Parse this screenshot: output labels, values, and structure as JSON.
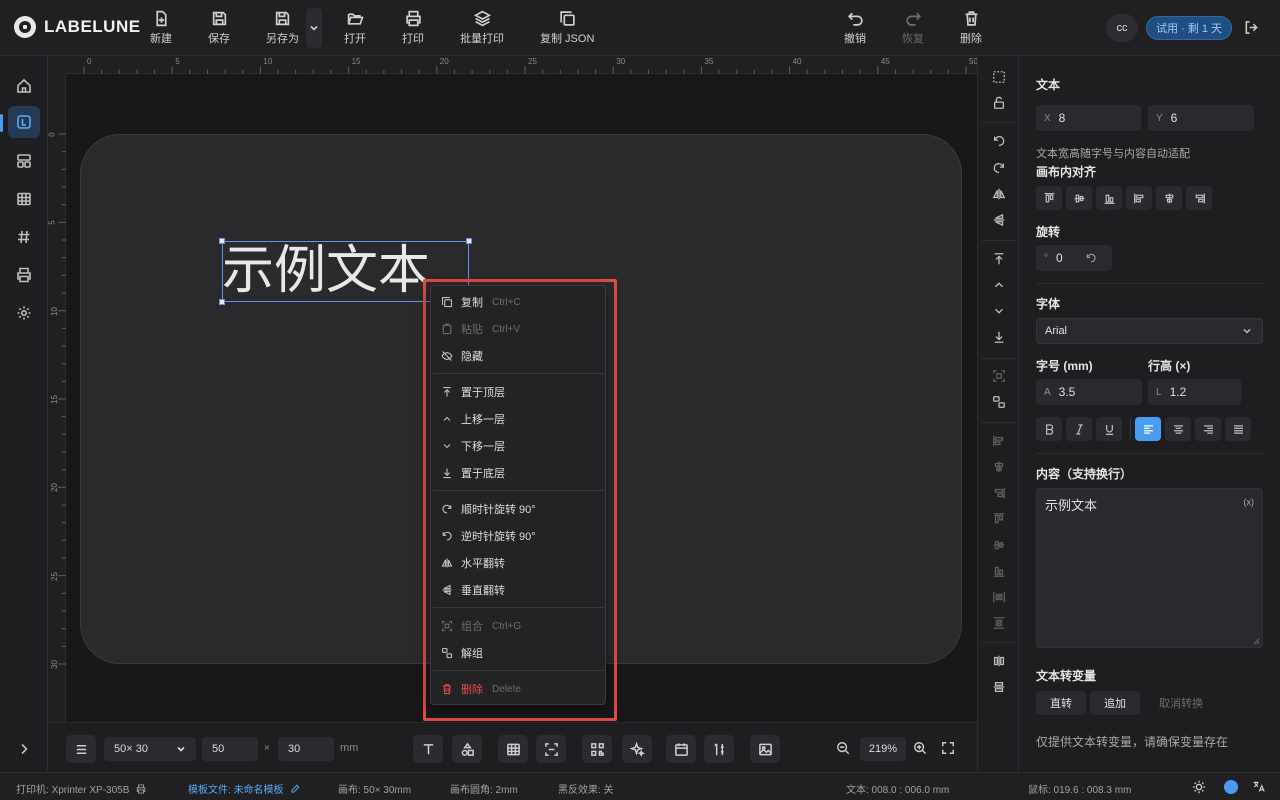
{
  "app": {
    "name": "LABELUNE"
  },
  "toolbar": {
    "new": "新建",
    "save": "保存",
    "save_as": "另存为",
    "open": "打开",
    "print": "打印",
    "batch_print": "批量打印",
    "copy_json": "复制 JSON",
    "undo": "撤销",
    "redo": "恢复",
    "delete": "删除"
  },
  "user": {
    "initials": "cc",
    "trial": "试用 · 剩 1 天"
  },
  "rulers": {
    "top": [
      "0",
      "5",
      "10",
      "15",
      "20",
      "25",
      "30",
      "35",
      "40",
      "45",
      "50"
    ],
    "left": [
      "0",
      "5",
      "10",
      "15",
      "20",
      "25",
      "30"
    ]
  },
  "canvas": {
    "sample_text": "示例文本"
  },
  "context_menu": {
    "items": [
      {
        "label": "复制",
        "shortcut": "Ctrl+C",
        "icon": "copy-icon",
        "disabled": false
      },
      {
        "label": "粘贴",
        "shortcut": "Ctrl+V",
        "icon": "paste-icon",
        "disabled": true
      },
      {
        "label": "隐藏",
        "shortcut": "",
        "icon": "eye-off-icon",
        "disabled": false
      },
      {
        "label": "置于顶层",
        "shortcut": "",
        "icon": "bring-to-front-icon",
        "disabled": false
      },
      {
        "label": "上移一层",
        "shortcut": "",
        "icon": "chevron-up-icon",
        "disabled": false
      },
      {
        "label": "下移一层",
        "shortcut": "",
        "icon": "chevron-down-icon",
        "disabled": false
      },
      {
        "label": "置于底层",
        "shortcut": "",
        "icon": "send-to-back-icon",
        "disabled": false
      },
      {
        "label": "顺时针旋转 90°",
        "shortcut": "",
        "icon": "rotate-cw-icon",
        "disabled": false
      },
      {
        "label": "逆时针旋转 90°",
        "shortcut": "",
        "icon": "rotate-ccw-icon",
        "disabled": false
      },
      {
        "label": "水平翻转",
        "shortcut": "",
        "icon": "flip-horizontal-icon",
        "disabled": false
      },
      {
        "label": "垂直翻转",
        "shortcut": "",
        "icon": "flip-vertical-icon",
        "disabled": false
      },
      {
        "label": "组合",
        "shortcut": "Ctrl+G",
        "icon": "group-icon",
        "disabled": true
      },
      {
        "label": "解组",
        "shortcut": "",
        "icon": "ungroup-icon",
        "disabled": false
      },
      {
        "label": "删除",
        "shortcut": "Delete",
        "icon": "trash-icon",
        "disabled": false
      }
    ]
  },
  "bottom": {
    "size_preset": "50× 30",
    "width": "50",
    "times": "×",
    "height": "30",
    "unit": "mm",
    "zoom": "219%"
  },
  "props": {
    "section_text": "文本",
    "x_label": "X",
    "x": "8",
    "y_label": "Y",
    "y": "6",
    "auto_fit_note": "文本宽高随字号与内容自动适配",
    "align_title": "画布内对齐",
    "rotate_title": "旋转",
    "rotate_unit": "°",
    "rotate": "0",
    "font_title": "字体",
    "font": "Arial",
    "size_title": "字号 (mm)",
    "size_label": "A",
    "size": "3.5",
    "line_title": "行高 (×)",
    "line_label": "L",
    "line": "1.2",
    "content_title": "内容（支持换行）",
    "content": "示例文本",
    "var_marker": "(x)",
    "var_title": "文本转变量",
    "var_direct": "直转",
    "var_add": "追加",
    "var_cancel": "取消转换",
    "var_note": "仅提供文本转变量，请确保变量存在"
  },
  "status": {
    "printer_label": "打印机:",
    "printer": "Xprinter XP-305B",
    "template_label": "模板文件:",
    "template": "未命名模板",
    "canvas": "画布: 50× 30mm",
    "corner": "画布圆角: 2mm",
    "invert": "黑反效果: 关",
    "text_pos": "文本: 008.0 : 006.0 mm",
    "mouse_pos": "鼠标: 019.6 : 008.3 mm"
  },
  "colors": {
    "accent": "#4a9cf0",
    "danger": "#e04a4a",
    "trial_bg": "#1f4f80"
  }
}
